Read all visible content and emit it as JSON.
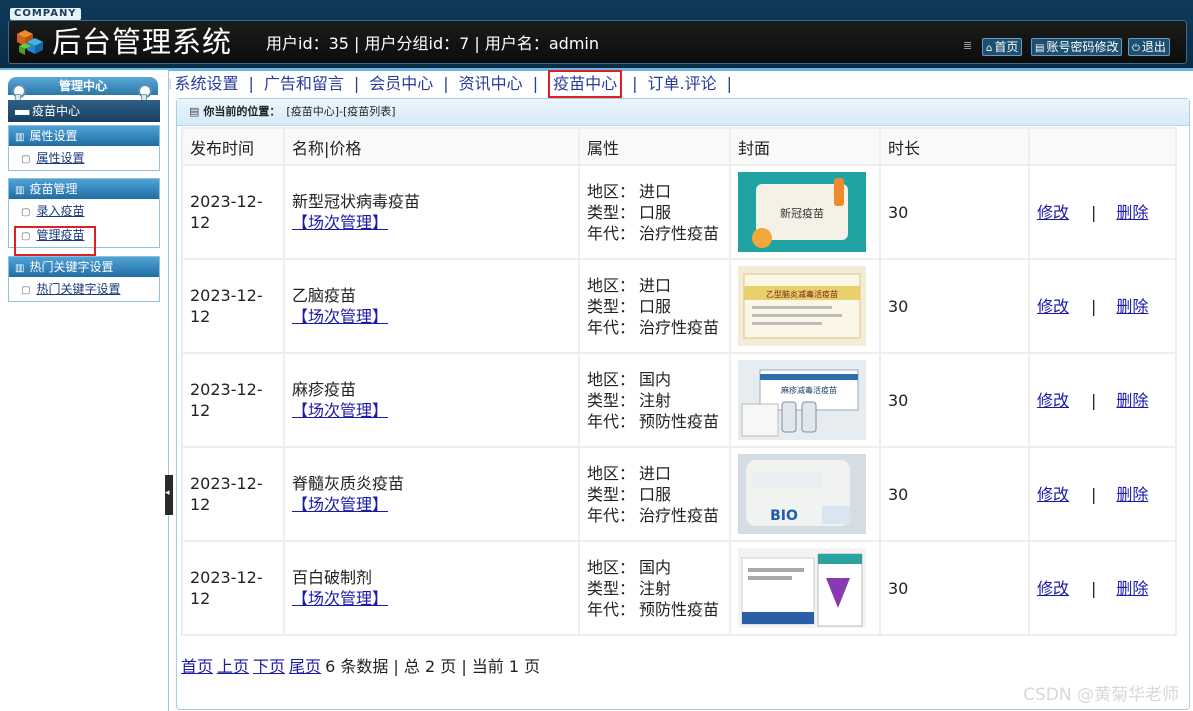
{
  "header": {
    "company": "COMPANY",
    "title": "后台管理系统",
    "user_info": "用户id：35 | 用户分组id：7 | 用户名：admin",
    "buttons": [
      {
        "icon": "home-icon",
        "label": "首页"
      },
      {
        "icon": "account-icon",
        "label": "账号密码修改"
      },
      {
        "icon": "power-icon",
        "label": "退出"
      }
    ]
  },
  "sidebar": {
    "tab": "管理中心",
    "section": "疫苗中心",
    "groups": [
      {
        "title": "属性设置",
        "items": [
          "属性设置"
        ]
      },
      {
        "title": "疫苗管理",
        "items": [
          "录入疫苗",
          "管理疫苗"
        ]
      },
      {
        "title": "热门关键字设置",
        "items": [
          "热门关键字设置"
        ]
      }
    ]
  },
  "topnav": {
    "items": [
      "系统设置",
      "广告和留言",
      "会员中心",
      "资讯中心",
      "疫苗中心",
      "订单.评论"
    ],
    "active_index": 4
  },
  "breadcrumb": {
    "label": "你当前的位置：",
    "path": "[疫苗中心]-[疫苗列表]"
  },
  "table": {
    "headers": [
      "发布时间",
      "名称|价格",
      "属性",
      "封面",
      "时长",
      ""
    ],
    "attr_keys": [
      "地区：",
      "类型：",
      "年代："
    ],
    "sched_label": "【场次管理】",
    "edit_label": "修改",
    "delete_label": "删除",
    "action_sep": "|",
    "rows": [
      {
        "date": "2023-12-12",
        "name": "新型冠状病毒疫苗",
        "region": "进口",
        "type": "口服",
        "era": "治疗性疫苗",
        "cover_text": "新冠疫苗",
        "duration": "30"
      },
      {
        "date": "2023-12-12",
        "name": "乙脑疫苗",
        "region": "进口",
        "type": "口服",
        "era": "治疗性疫苗",
        "cover_text": "乙型脑炎减毒活疫苗",
        "duration": "30"
      },
      {
        "date": "2023-12-12",
        "name": "麻疹疫苗",
        "region": "国内",
        "type": "注射",
        "era": "预防性疫苗",
        "cover_text": "麻疹减毒活疫苗",
        "duration": "30"
      },
      {
        "date": "2023-12-12",
        "name": "脊髓灰质炎疫苗",
        "region": "进口",
        "type": "口服",
        "era": "治疗性疫苗",
        "cover_text": "BIO",
        "duration": "30"
      },
      {
        "date": "2023-12-12",
        "name": "百白破制剂",
        "region": "国内",
        "type": "注射",
        "era": "预防性疫苗",
        "cover_text": "",
        "duration": "30"
      }
    ]
  },
  "pager": {
    "links": [
      "首页",
      "上页",
      "下页",
      "尾页"
    ],
    "summary": "6 条数据 | 总 2 页 | 当前 1 页"
  },
  "watermark": "CSDN @黄菊华老师"
}
